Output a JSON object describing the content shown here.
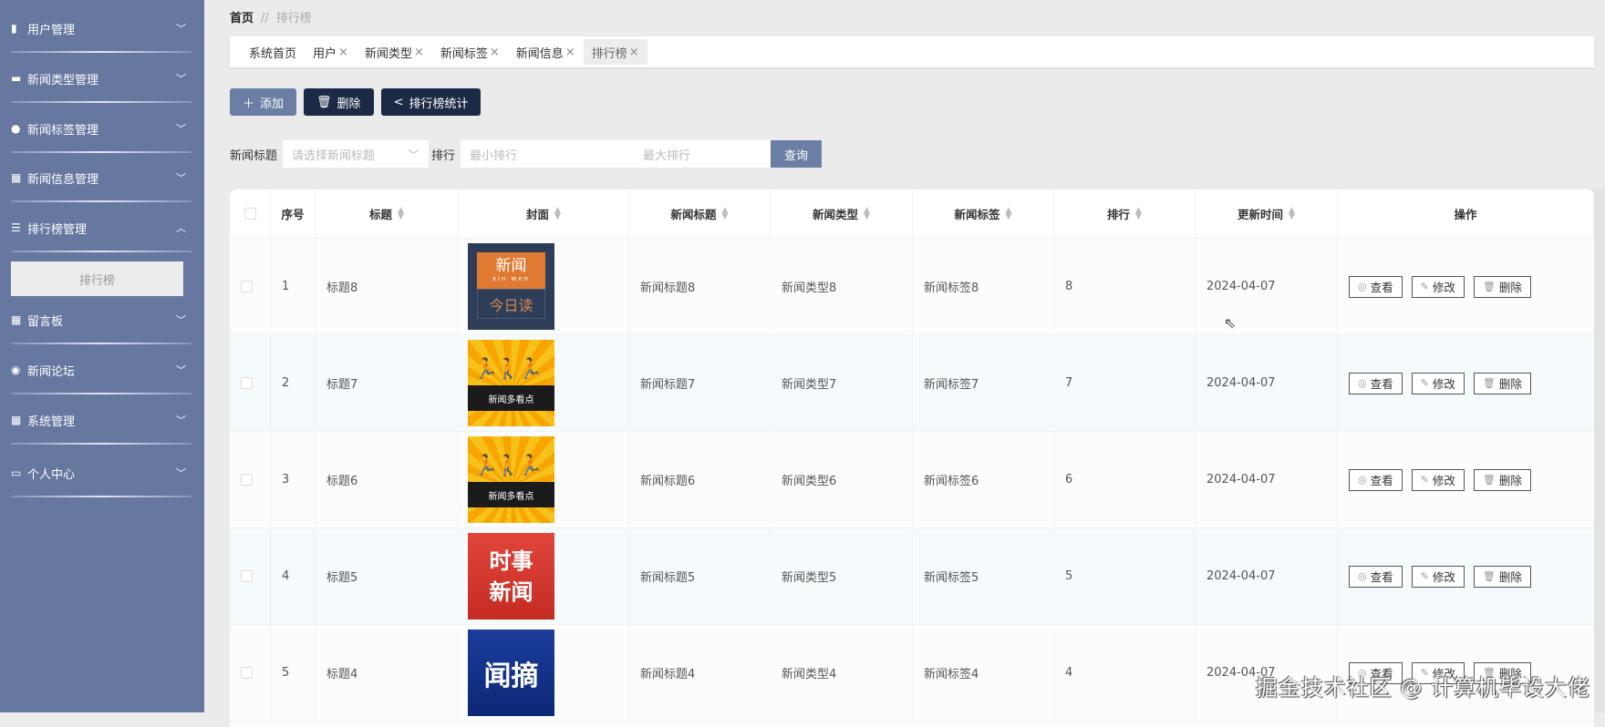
{
  "sidebar": {
    "items": [
      {
        "label": "用户管理",
        "icon": "book-icon",
        "expanded": false
      },
      {
        "label": "新闻类型管理",
        "icon": "monitor-icon",
        "expanded": false
      },
      {
        "label": "新闻标签管理",
        "icon": "user-icon",
        "expanded": false
      },
      {
        "label": "新闻信息管理",
        "icon": "grid-icon",
        "expanded": false
      },
      {
        "label": "排行榜管理",
        "icon": "list-icon",
        "expanded": true
      },
      {
        "label": "留言板",
        "icon": "grid-icon",
        "expanded": false
      },
      {
        "label": "新闻论坛",
        "icon": "location-icon",
        "expanded": false
      },
      {
        "label": "系统管理",
        "icon": "grid-icon",
        "expanded": false
      },
      {
        "label": "个人中心",
        "icon": "card-icon",
        "expanded": false
      }
    ],
    "subitem": "排行榜"
  },
  "breadcrumb": {
    "home": "首页",
    "sep": "//",
    "current": "排行榜"
  },
  "tabs": [
    {
      "label": "系统首页",
      "closable": false
    },
    {
      "label": "用户",
      "closable": true
    },
    {
      "label": "新闻类型",
      "closable": true
    },
    {
      "label": "新闻标签",
      "closable": true
    },
    {
      "label": "新闻信息",
      "closable": true
    },
    {
      "label": "排行榜",
      "closable": true,
      "active": true
    }
  ],
  "close_glyph": "×",
  "toolbar": {
    "add": "添加",
    "delete": "删除",
    "stats": "排行榜统计"
  },
  "search": {
    "title_label": "新闻标题",
    "title_placeholder": "请选择新闻标题",
    "rank_label": "排行",
    "min_placeholder": "最小排行",
    "max_placeholder": "最大排行",
    "query": "查询"
  },
  "table": {
    "headers": [
      "序号",
      "标题",
      "封面",
      "新闻标题",
      "新闻类型",
      "新闻标签",
      "排行",
      "更新时间",
      "操作"
    ],
    "actions": {
      "view": "查看",
      "edit": "修改",
      "delete": "删除"
    },
    "rows": [
      {
        "no": "1",
        "title": "标题8",
        "cover": [
          "新闻",
          "xin wen",
          "今日读"
        ],
        "news_title": "新闻标题8",
        "type": "新闻类型8",
        "tag": "新闻标签8",
        "rank": "8",
        "time": "2024-04-07"
      },
      {
        "no": "2",
        "title": "标题7",
        "cover": [
          "新闻多看点"
        ],
        "news_title": "新闻标题7",
        "type": "新闻类型7",
        "tag": "新闻标签7",
        "rank": "7",
        "time": "2024-04-07"
      },
      {
        "no": "3",
        "title": "标题6",
        "cover": [
          "新闻多看点"
        ],
        "news_title": "新闻标题6",
        "type": "新闻类型6",
        "tag": "新闻标签6",
        "rank": "6",
        "time": "2024-04-07"
      },
      {
        "no": "4",
        "title": "标题5",
        "cover": [
          "时事",
          "新闻"
        ],
        "news_title": "新闻标题5",
        "type": "新闻类型5",
        "tag": "新闻标签5",
        "rank": "5",
        "time": "2024-04-07"
      },
      {
        "no": "5",
        "title": "标题4",
        "cover": [
          "闻摘"
        ],
        "news_title": "新闻标题4",
        "type": "新闻类型4",
        "tag": "新闻标签4",
        "rank": "4",
        "time": "2024-04-07"
      }
    ]
  },
  "watermark": "掘金技术社区 @ 计算机毕设大佬"
}
